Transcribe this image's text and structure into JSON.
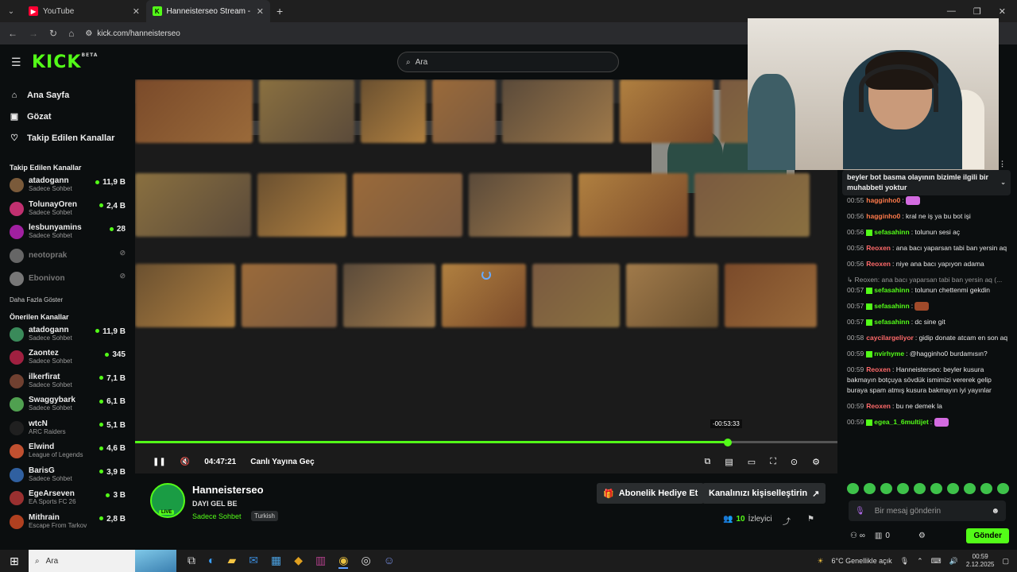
{
  "browser": {
    "tabs": [
      {
        "label": "YouTube",
        "active": false
      },
      {
        "label": "Hanneisterseo Stream - Watch",
        "active": true
      }
    ],
    "url": "kick.com/hanneisterseo"
  },
  "header": {
    "logo": "KICK",
    "logo_badge": "BETA",
    "search_placeholder": "Ara"
  },
  "sidebar": {
    "nav": [
      {
        "label": "Ana Sayfa",
        "icon": "home-icon"
      },
      {
        "label": "Gözat",
        "icon": "browse-icon"
      },
      {
        "label": "Takip Edilen Kanallar",
        "icon": "heart-icon"
      }
    ],
    "followed_title": "Takip Edilen Kanallar",
    "followed": [
      {
        "name": "atadogann",
        "category": "Sadece Sohbet",
        "viewers": "11,9 B",
        "online": true
      },
      {
        "name": "TolunayOren",
        "category": "Sadece Sohbet",
        "viewers": "2,4 B",
        "online": true
      },
      {
        "name": "lesbunyamins",
        "category": "Sadece Sohbet",
        "viewers": "28",
        "online": true
      },
      {
        "name": "neotoprak",
        "category": "",
        "viewers": "",
        "online": false
      },
      {
        "name": "Ebonivon",
        "category": "",
        "viewers": "",
        "online": false
      }
    ],
    "show_more": "Daha Fazla Göster",
    "recommended_title": "Önerilen Kanallar",
    "recommended": [
      {
        "name": "atadogann",
        "category": "Sadece Sohbet",
        "viewers": "11,9 B"
      },
      {
        "name": "Zaontez",
        "category": "Sadece Sohbet",
        "viewers": "345"
      },
      {
        "name": "ilkerfirat",
        "category": "Sadece Sohbet",
        "viewers": "7,1 B"
      },
      {
        "name": "Swaggybark",
        "category": "Sadece Sohbet",
        "viewers": "6,1 B"
      },
      {
        "name": "wtcN",
        "category": "ARC Raiders",
        "viewers": "5,1 B"
      },
      {
        "name": "Elwind",
        "category": "League of Legends",
        "viewers": "4,6 B"
      },
      {
        "name": "BarisG",
        "category": "Sadece Sohbet",
        "viewers": "3,9 B"
      },
      {
        "name": "EgeArseven",
        "category": "EA Sports FC 26",
        "viewers": "3 B"
      },
      {
        "name": "Mithrain",
        "category": "Escape From Tarkov",
        "viewers": "2,8 B"
      }
    ]
  },
  "player": {
    "elapsed": "04:47:21",
    "go_live": "Canlı Yayına Geç",
    "seek_tooltip": "-00:53:33",
    "progress_fraction": 0.844
  },
  "stream": {
    "channel": "Hanneisterseo",
    "title": "DAYI GEL BE",
    "category": "Sadece Sohbet",
    "language": "Turkish",
    "live_badge": "LIVE",
    "gift_button": "Abonelik Hediye Et",
    "customize_button": "Kanalınızı kişiselleştirin",
    "viewer_count": "10",
    "viewer_label": "İzleyici"
  },
  "chat": {
    "pinned": "beyler bot basma olayının bizimle ilgili bir muhabbeti yoktur",
    "messages": [
      {
        "time": "00:55",
        "user": "hagginho0",
        "text": "",
        "color": "#ff7a4a"
      },
      {
        "time": "00:56",
        "user": "hagginho0",
        "text": "kral ne iş ya bu bot işi",
        "color": "#ff7a4a"
      },
      {
        "time": "00:56",
        "user": "sefasahinn",
        "text": "tolunun sesi aç",
        "color": "#53fc18"
      },
      {
        "time": "00:56",
        "user": "Reoxen",
        "text": "ana bacı yaparsan tabi ban yersin aq",
        "color": "#ff6a6a"
      },
      {
        "time": "00:56",
        "user": "Reoxen",
        "text": "niye ana bacı yapıyon adama",
        "color": "#ff6a6a"
      },
      {
        "time": "",
        "user": "",
        "text": "↳ Reoxen: ana bacı yaparsan tabi ban yersin aq (...",
        "color": "#999"
      },
      {
        "time": "00:57",
        "user": "sefasahinn",
        "text": "tolunun chettenmi gekdin",
        "color": "#53fc18"
      },
      {
        "time": "00:57",
        "user": "sefasahinn",
        "text": "",
        "color": "#53fc18"
      },
      {
        "time": "00:57",
        "user": "sefasahinn",
        "text": "dc sine git",
        "color": "#53fc18"
      },
      {
        "time": "00:58",
        "user": "caycilargeliyor",
        "text": "gidip donate atcam en son aq",
        "color": "#ff6a6a"
      },
      {
        "time": "00:59",
        "user": "nvirhyme",
        "text": "@hagginho0 burdamısın?",
        "color": "#53fc18"
      },
      {
        "time": "00:59",
        "user": "Reoxen",
        "text": "Hanneisterseo: beyler kusura bakmayın botçuya sövdük ismimizi vererek gelip buraya spam atmış kusura bakmayın iyi yayınlar",
        "color": "#ff6a6a"
      },
      {
        "time": "00:59",
        "user": "Reoxen",
        "text": "bu ne demek la",
        "color": "#ff6a6a"
      },
      {
        "time": "00:59",
        "user": "egea_1_6multijet",
        "text": "",
        "color": "#53fc18"
      }
    ],
    "input_placeholder": "Bir mesaj gönderin",
    "points": "0",
    "send_label": "Gönder"
  },
  "taskbar": {
    "search": "Ara",
    "weather": "6°C  Genellikle açık",
    "time": "00:59",
    "date": "2.12.2025"
  },
  "colors": {
    "accent": "#53fc18",
    "background": "#0b0e0f"
  }
}
